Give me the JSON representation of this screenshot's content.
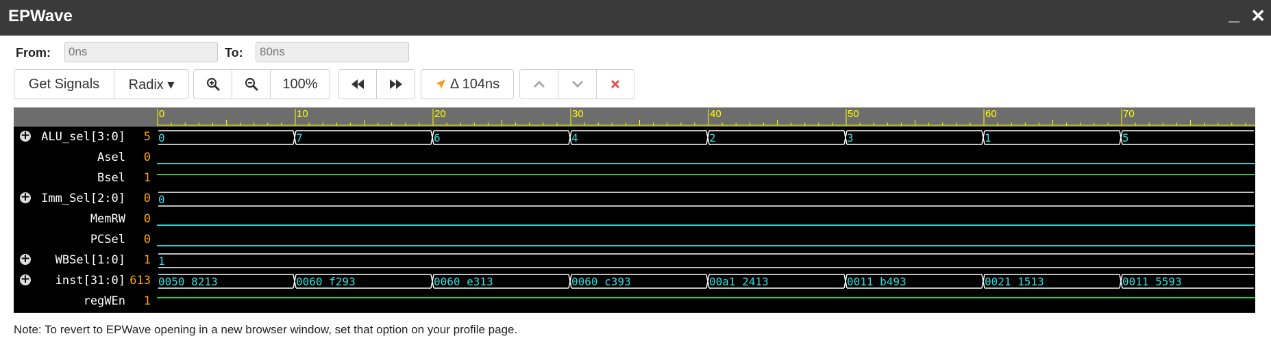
{
  "window": {
    "title": "EPWave",
    "minimize": "_",
    "close": "✕"
  },
  "range": {
    "from_label": "From:",
    "from_value": "0ns",
    "to_label": "To:",
    "to_value": "80ns"
  },
  "toolbar": {
    "get_signals": "Get Signals",
    "radix": "Radix ▾",
    "zoom_level": "100%",
    "delta": "Δ 104ns",
    "icons": [
      "zoom-in-icon",
      "zoom-out-icon",
      "rewind-icon",
      "fast-forward-icon",
      "cursor-arrow-icon",
      "chevron-up-icon",
      "chevron-down-icon",
      "close-icon"
    ],
    "colors": {
      "delete": "#e05050",
      "delta_arrow": "#f0a020"
    }
  },
  "timeline": {
    "ticks": [
      "0",
      "10",
      "20",
      "30",
      "40",
      "50",
      "60",
      "70"
    ],
    "t_max": 80
  },
  "signals": [
    {
      "name": "ALU_sel[3:0]",
      "value": "5",
      "expandable": true,
      "type": "bus",
      "segments": [
        {
          "t": 0,
          "v": "0"
        },
        {
          "t": 10,
          "v": "7"
        },
        {
          "t": 20,
          "v": "6"
        },
        {
          "t": 30,
          "v": "4"
        },
        {
          "t": 40,
          "v": "2"
        },
        {
          "t": 50,
          "v": "3"
        },
        {
          "t": 60,
          "v": "1"
        },
        {
          "t": 70,
          "v": "5"
        }
      ]
    },
    {
      "name": "Asel",
      "value": "0",
      "expandable": false,
      "type": "bit",
      "level": 0
    },
    {
      "name": "Bsel",
      "value": "1",
      "expandable": false,
      "type": "bit",
      "level": 1
    },
    {
      "name": "Imm_Sel[2:0]",
      "value": "0",
      "expandable": true,
      "type": "bus",
      "segments": [
        {
          "t": 0,
          "v": "0"
        }
      ]
    },
    {
      "name": "MemRW",
      "value": "0",
      "expandable": false,
      "type": "bit",
      "level": 0
    },
    {
      "name": "PCSel",
      "value": "0",
      "expandable": false,
      "type": "bit",
      "level": 0
    },
    {
      "name": "WBSel[1:0]",
      "value": "1",
      "expandable": true,
      "type": "bus",
      "segments": [
        {
          "t": 0,
          "v": "1"
        }
      ]
    },
    {
      "name": "inst[31:0]",
      "value": "613",
      "expandable": true,
      "type": "bus",
      "segments": [
        {
          "t": 0,
          "v": "0050_8213"
        },
        {
          "t": 10,
          "v": "0060_f293"
        },
        {
          "t": 20,
          "v": "0060_e313"
        },
        {
          "t": 30,
          "v": "0060_c393"
        },
        {
          "t": 40,
          "v": "00a1_2413"
        },
        {
          "t": 50,
          "v": "0011_b493"
        },
        {
          "t": 60,
          "v": "0021_1513"
        },
        {
          "t": 70,
          "v": "0011_5593"
        }
      ]
    },
    {
      "name": "regWEn",
      "value": "1",
      "expandable": false,
      "type": "bit",
      "level": 1
    }
  ],
  "colors": {
    "title_bar": "#3a3a3a",
    "ruler_tick": "#ffff00",
    "ruler_bg": "#6d6d6d",
    "bus_line": "#ffffff",
    "bus_text": "#33e0e0",
    "bit_low": "#33d0d0",
    "bit_high": "#33cc33",
    "signal_value": "#ffa500"
  },
  "note": "Note: To revert to EPWave opening in a new browser window, set that option on your profile page."
}
